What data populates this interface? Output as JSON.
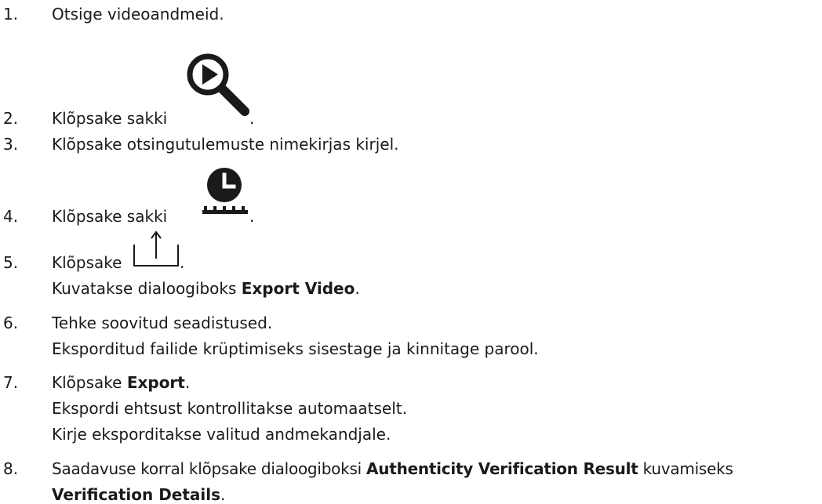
{
  "steps": [
    {
      "num": "1.",
      "text": "Otsige videoandmeid."
    },
    {
      "num": "2.",
      "text": "Klõpsake sakki",
      "after": ".",
      "icon": "search-play-icon"
    },
    {
      "num": "3.",
      "text": "Klõpsake otsingutulemuste nimekirjas kirjel."
    },
    {
      "num": "4.",
      "text": "Klõpsake sakki",
      "after": ".",
      "icon": "clock-timeline-icon"
    },
    {
      "num": "5.",
      "text": "Klõpsake",
      "after": ".",
      "icon": "export-icon",
      "result_pre": "Kuvatakse dialoogiboks ",
      "result_bold": "Export Video",
      "result_post": "."
    },
    {
      "num": "6.",
      "text": "Tehke soovitud seadistused.",
      "result": "Eksporditud failide krüptimiseks sisestage ja kinnitage parool."
    },
    {
      "num": "7.",
      "text_pre": "Klõpsake ",
      "text_bold": "Export",
      "text_post": ".",
      "result1": "Ekspordi ehtsust kontrollitakse automaatselt.",
      "result2": "Kirje eksporditakse valitud andmekandjale."
    },
    {
      "num": "8.",
      "text_pre": "Saadavuse korral klõpsake dialoogiboksi ",
      "text_bold": "Authenticity Verification Result",
      "text_post": " kuvamiseks",
      "line2_bold": "Verification Details",
      "line2_post": "."
    }
  ],
  "icon_colors": {
    "search": "#1a1a1a",
    "clock": "#1a1a1a"
  }
}
